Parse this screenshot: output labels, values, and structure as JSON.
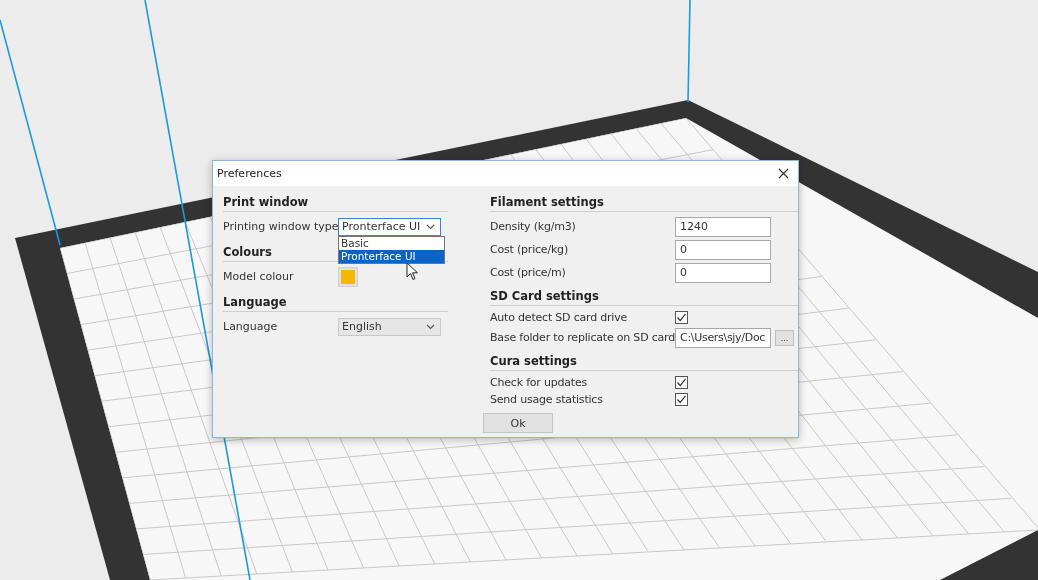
{
  "window": {
    "title": "Preferences"
  },
  "left_sections": [
    {
      "title": "Print window",
      "rows": [
        {
          "kind": "combo",
          "label": "Printing window type",
          "value": "Pronterface UI",
          "expanded": true,
          "options": [
            {
              "label": "Basic",
              "selected": false
            },
            {
              "label": "Pronterface UI",
              "selected": true
            }
          ]
        }
      ]
    },
    {
      "title": "Colours",
      "rows": [
        {
          "kind": "color",
          "label": "Model colour",
          "color": "#f5b800"
        }
      ]
    },
    {
      "title": "Language",
      "rows": [
        {
          "kind": "combo",
          "label": "Language",
          "value": "English",
          "expanded": false
        }
      ]
    }
  ],
  "right_sections": [
    {
      "title": "Filament settings",
      "rows": [
        {
          "kind": "text",
          "label": "Density (kg/m3)",
          "value": "1240"
        },
        {
          "kind": "text",
          "label": "Cost (price/kg)",
          "value": "0"
        },
        {
          "kind": "text",
          "label": "Cost (price/m)",
          "value": "0"
        }
      ]
    },
    {
      "title": "SD Card settings",
      "rows": [
        {
          "kind": "check",
          "label": "Auto detect SD card drive",
          "checked": true
        },
        {
          "kind": "path",
          "label": "Base folder to replicate on SD card",
          "value": "C:\\Users\\sjy/Doc",
          "browse": "..."
        }
      ]
    },
    {
      "title": "Cura settings",
      "rows": [
        {
          "kind": "check",
          "label": "Check for updates",
          "checked": true
        },
        {
          "kind": "check",
          "label": "Send usage statistics",
          "checked": true
        }
      ]
    }
  ],
  "buttons": [
    {
      "label": "Ok"
    }
  ]
}
